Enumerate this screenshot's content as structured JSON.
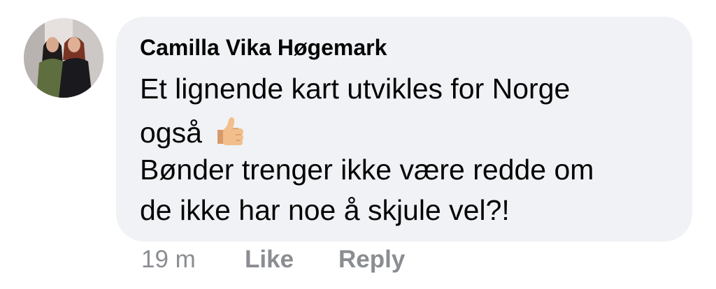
{
  "comment": {
    "author": "Camilla Vika Høgemark",
    "lines": [
      "Et lignende kart utvikles for Norge",
      "også",
      "Bønder trenger ikke være redde om",
      "de ikke har noe å skjule vel?!"
    ],
    "emoji": "thumbs-up-icon"
  },
  "actions": {
    "time": "19 m",
    "like": "Like",
    "reply": "Reply"
  },
  "colors": {
    "bubble": "#f0f2f5",
    "text": "#050505",
    "meta": "#8a8d91"
  }
}
